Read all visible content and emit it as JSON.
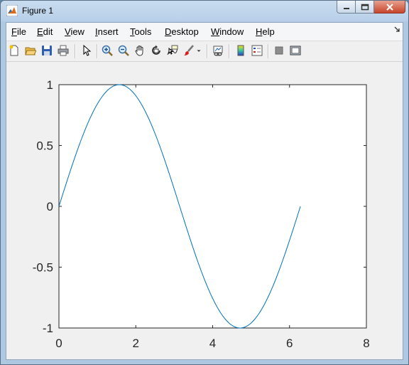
{
  "window": {
    "title": "Figure 1",
    "accent": "#b8d0e8"
  },
  "menubar": {
    "items": [
      {
        "label": "File",
        "u": "F",
        "rest": "ile"
      },
      {
        "label": "Edit",
        "u": "E",
        "rest": "dit"
      },
      {
        "label": "View",
        "u": "V",
        "rest": "iew"
      },
      {
        "label": "Insert",
        "u": "I",
        "rest": "nsert"
      },
      {
        "label": "Tools",
        "u": "T",
        "rest": "ools"
      },
      {
        "label": "Desktop",
        "u": "D",
        "rest": "esktop"
      },
      {
        "label": "Window",
        "u": "W",
        "rest": "indow"
      },
      {
        "label": "Help",
        "u": "H",
        "rest": "elp"
      }
    ]
  },
  "toolbar": {
    "icons": [
      "new-figure-icon",
      "open-file-icon",
      "save-figure-icon",
      "print-figure-icon",
      "edit-plot-icon",
      "zoom-in-icon",
      "zoom-out-icon",
      "pan-icon",
      "rotate-3d-icon",
      "data-cursor-icon",
      "brush-icon",
      "link-plot-icon",
      "colorbar-icon",
      "legend-icon",
      "hide-plot-tools-icon",
      "show-plot-tools-icon"
    ]
  },
  "chart_data": {
    "type": "line",
    "title": "",
    "xlabel": "",
    "ylabel": "",
    "xlim": [
      0,
      8
    ],
    "ylim": [
      -1,
      1
    ],
    "xticks": [
      0,
      2,
      4,
      6,
      8
    ],
    "yticks": [
      -1,
      -0.5,
      0,
      0.5,
      1
    ],
    "xtick_labels": [
      "0",
      "2",
      "4",
      "6",
      "8"
    ],
    "ytick_labels": [
      "-1",
      "-0.5",
      "0",
      "0.5",
      "1"
    ],
    "grid": false,
    "series": [
      {
        "color": "#0072bd",
        "function": "sin(x)",
        "x_range": [
          0,
          6.2832
        ]
      }
    ]
  }
}
